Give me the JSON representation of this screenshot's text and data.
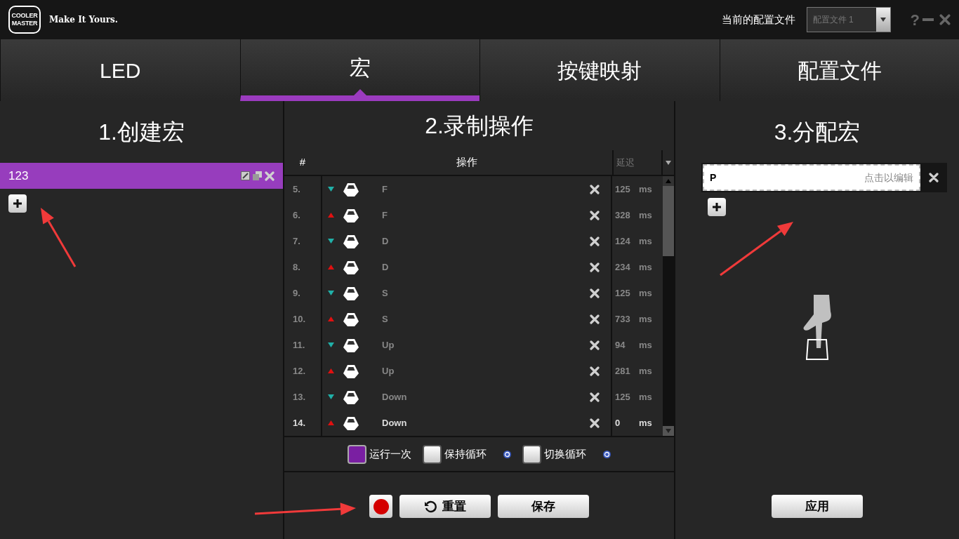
{
  "header": {
    "logo": [
      "COOLER",
      "MASTER"
    ],
    "slogan": "Make It Yours.",
    "profile_label": "当前的配置文件",
    "profile_value": "配置文件 1",
    "help": "?"
  },
  "tabs": [
    {
      "label": "LED",
      "selected": false
    },
    {
      "label": "宏",
      "selected": true
    },
    {
      "label": "按键映射",
      "selected": false
    },
    {
      "label": "配置文件",
      "selected": false
    }
  ],
  "create": {
    "title": "1.创建宏",
    "macros": [
      {
        "name": "123",
        "selected": true
      }
    ]
  },
  "record": {
    "title": "2.录制操作",
    "columns": [
      "#",
      "操作",
      "延迟"
    ],
    "rows": [
      {
        "index": "5.",
        "kind": "press",
        "key": "F",
        "delay": "125",
        "unit": "ms",
        "selected": false
      },
      {
        "index": "6.",
        "kind": "release",
        "key": "F",
        "delay": "328",
        "unit": "ms",
        "selected": false
      },
      {
        "index": "7.",
        "kind": "press",
        "key": "D",
        "delay": "124",
        "unit": "ms",
        "selected": false
      },
      {
        "index": "8.",
        "kind": "release",
        "key": "D",
        "delay": "234",
        "unit": "ms",
        "selected": false
      },
      {
        "index": "9.",
        "kind": "press",
        "key": "S",
        "delay": "125",
        "unit": "ms",
        "selected": false
      },
      {
        "index": "10.",
        "kind": "release",
        "key": "S",
        "delay": "733",
        "unit": "ms",
        "selected": false
      },
      {
        "index": "11.",
        "kind": "press",
        "key": "Up",
        "delay": "94",
        "unit": "ms",
        "selected": false
      },
      {
        "index": "12.",
        "kind": "release",
        "key": "Up",
        "delay": "281",
        "unit": "ms",
        "selected": false
      },
      {
        "index": "13.",
        "kind": "press",
        "key": "Down",
        "delay": "125",
        "unit": "ms",
        "selected": false
      },
      {
        "index": "14.",
        "kind": "release",
        "key": "Down",
        "delay": "0",
        "unit": "ms",
        "selected": true
      }
    ],
    "options": [
      {
        "label": "运行一次",
        "checked": true,
        "help": false
      },
      {
        "label": "保持循环",
        "checked": false,
        "help": true
      },
      {
        "label": "切换循环",
        "checked": false,
        "help": true
      }
    ],
    "buttons": {
      "reset": "重置",
      "save": "保存"
    }
  },
  "assign": {
    "title": "3.分配宏",
    "items": [
      {
        "key": "P",
        "hint": "点击以编辑"
      }
    ],
    "apply": "应用"
  }
}
